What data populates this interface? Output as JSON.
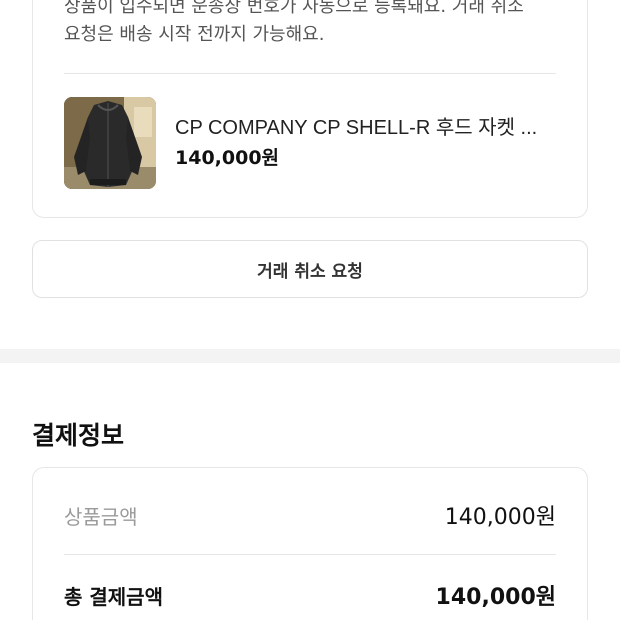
{
  "order": {
    "notice_lines": [
      "상품이 입수되면 운송장 번호가 자동으로 등록돼요. 거래 취소",
      "요청은 배송 시작 전까지 가능해요."
    ],
    "product": {
      "image_icon": "jacket-thumbnail",
      "name": "CP COMPANY CP SHELL-R 후드 자켓 ...",
      "price": "140,000원"
    }
  },
  "cancel_button_label": "거래 취소 요청",
  "payment": {
    "title": "결제정보",
    "rows": [
      {
        "label": "상품금액",
        "value": "140,000원"
      },
      {
        "label": "총 결제금액",
        "value": "140,000원"
      }
    ]
  },
  "colors": {
    "border": "#e6e6e6",
    "muted_text": "#9a9a9a",
    "section_gap": "#f3f3f3"
  }
}
